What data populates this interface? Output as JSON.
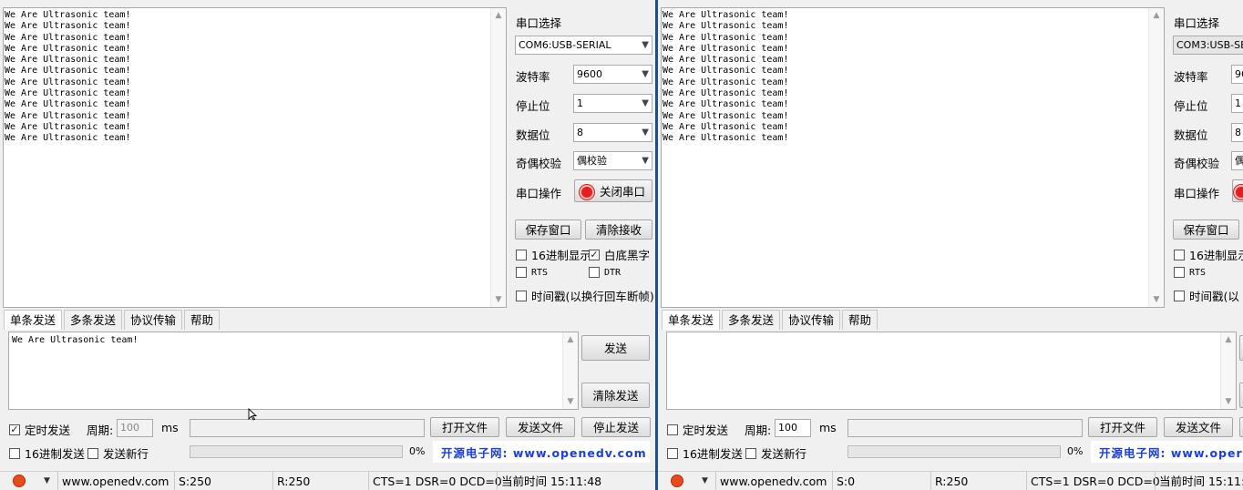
{
  "left": {
    "receive_lines": "We Are Ultrasonic team!\nWe Are Ultrasonic team!\nWe Are Ultrasonic team!\nWe Are Ultrasonic team!\nWe Are Ultrasonic team!\nWe Are Ultrasonic team!\nWe Are Ultrasonic team!\nWe Are Ultrasonic team!\nWe Are Ultrasonic team!\nWe Are Ultrasonic team!\nWe Are Ultrasonic team!\nWe Are Ultrasonic team!",
    "settings": {
      "port_label": "串口选择",
      "port_value": "COM6:USB-SERIAL",
      "baud_label": "波特率",
      "baud_value": "9600",
      "stop_label": "停止位",
      "stop_value": "1",
      "data_label": "数据位",
      "data_value": "8",
      "parity_label": "奇偶校验",
      "parity_value": "偶校验",
      "op_label": "串口操作",
      "op_button": "关闭串口"
    },
    "buttons": {
      "save_window": "保存窗口",
      "clear_receive": "清除接收"
    },
    "options": {
      "hex_display": "16进制显示",
      "white_black": "白底黑字",
      "rts": "RTS",
      "dtr": "DTR",
      "timestamp": "时间戳(以换行回车断帧)"
    },
    "tabs": [
      "单条发送",
      "多条发送",
      "协议传输",
      "帮助"
    ],
    "send_text": "We Are Ultrasonic team!",
    "send_button": "发送",
    "clear_send_button": "清除发送",
    "timed_send": "定时发送",
    "period_label": "周期:",
    "period_value": "100",
    "ms_label": "ms",
    "open_file": "打开文件",
    "send_file": "发送文件",
    "stop_send": "停止发送",
    "hex_send": "16进制发送",
    "send_newline": "发送新行",
    "progress_pct": "0%",
    "progress_fraction": 0,
    "site_link": "开源电子网: www.openedv.com",
    "status": {
      "url": "www.openedv.com",
      "sent": "S:250",
      "received": "R:250",
      "lines": "CTS=1 DSR=0 DCD=0",
      "time": "当前时间 15:11:48"
    }
  },
  "right": {
    "receive_lines": "We Are Ultrasonic team!\nWe Are Ultrasonic team!\nWe Are Ultrasonic team!\nWe Are Ultrasonic team!\nWe Are Ultrasonic team!\nWe Are Ultrasonic team!\nWe Are Ultrasonic team!\nWe Are Ultrasonic team!\nWe Are Ultrasonic team!\nWe Are Ultrasonic team!\nWe Are Ultrasonic team!\nWe Are Ultrasonic team!",
    "settings": {
      "port_label": "串口选择",
      "port_value": "COM3:USB-SER",
      "baud_label": "波特率",
      "baud_value": "96",
      "stop_label": "停止位",
      "stop_value": "1",
      "data_label": "数据位",
      "data_value": "8",
      "parity_label": "奇偶校验",
      "parity_value": "偶",
      "op_label": "串口操作"
    },
    "buttons": {
      "save_window": "保存窗口"
    },
    "options": {
      "hex_display": "16进制显示",
      "rts": "RTS",
      "timestamp": "时间戳(以"
    },
    "tabs": [
      "单条发送",
      "多条发送",
      "协议传输",
      "帮助"
    ],
    "send_text": "",
    "timed_send": "定时发送",
    "period_label": "周期:",
    "period_value": "100",
    "ms_label": "ms",
    "open_file": "打开文件",
    "send_file": "发送文件",
    "hex_send": "16进制发送",
    "send_newline": "发送新行",
    "progress_pct": "0%",
    "progress_fraction": 0,
    "site_link": "开源电子网: www.oper",
    "status": {
      "url": "www.openedv.com",
      "sent": "S:0",
      "received": "R:250",
      "lines": "CTS=1 DSR=0 DCD=0",
      "time": "当前时间 15:11:4"
    }
  }
}
